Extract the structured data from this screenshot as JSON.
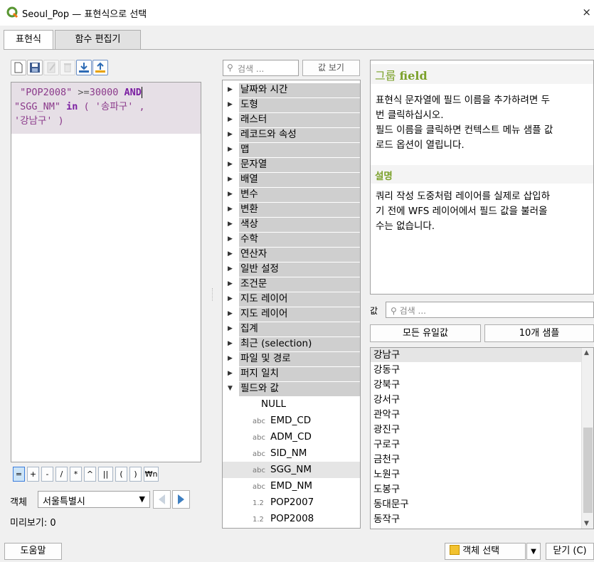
{
  "window": {
    "title": "Seoul_Pop — 표현식으로 선택",
    "close_glyph": "×"
  },
  "tabs": [
    {
      "label": "표현식",
      "active": true
    },
    {
      "label": "함수 편집기",
      "active": false
    }
  ],
  "toolbar_icons": [
    "new-file-icon",
    "save-icon",
    "edit-icon",
    "delete-icon",
    "load-icon",
    "export-icon"
  ],
  "expression": {
    "line1": {
      "pre": " ",
      "field": "\"POP2008\"",
      "op": " >=",
      "num": "30000",
      "kw": " AND"
    },
    "line2": {
      "field": "\"SGG_NM\"",
      "kw": " in",
      "rest": " ( '송파구' ,"
    },
    "line3": {
      "rest": "'강남구' )"
    }
  },
  "operators": [
    "=",
    "+",
    "-",
    "/",
    "*",
    "^",
    "||",
    "(",
    ")",
    "₩n"
  ],
  "feature": {
    "label": "객체",
    "selected": "서울특별시"
  },
  "preview": "미리보기:  0",
  "function_search": {
    "placeholder": "검색 ..."
  },
  "show_values_label": "값 보기",
  "function_groups": [
    "날짜와 시간",
    "도형",
    "래스터",
    "레코드와 속성",
    "맵",
    "문자열",
    "배열",
    "변수",
    "변환",
    "색상",
    "수학",
    "연산자",
    "일반 설정",
    "조건문",
    "지도 레이어",
    "지도 레이어",
    "집계",
    "최근 (selection)",
    "파일 및 경로",
    "퍼지 일치",
    "필드와 값"
  ],
  "fields": [
    {
      "type": "",
      "name": "NULL"
    },
    {
      "type": "abc",
      "name": "EMD_CD"
    },
    {
      "type": "abc",
      "name": "ADM_CD"
    },
    {
      "type": "abc",
      "name": "SID_NM"
    },
    {
      "type": "abc",
      "name": "SGG_NM",
      "selected": true
    },
    {
      "type": "abc",
      "name": "EMD_NM"
    },
    {
      "type": "1.2",
      "name": "POP2007"
    },
    {
      "type": "1.2",
      "name": "POP2008"
    }
  ],
  "help": {
    "title_prefix": "그룹",
    "title_name": "field",
    "para1_lines": [
      "표현식 문자열에 필드 이름을 추가하려면 두",
      "번 클릭하십시오."
    ],
    "para2_lines": [
      "필드 이름을 클릭하면 컨텍스트 메뉴 샘플 값",
      "로드 옵션이 열립니다."
    ],
    "desc_title": "설명",
    "desc_lines": [
      "쿼리 작성 도중처럼 레이어를 실제로 삽입하",
      "기 전에 WFS 레이어에서 필드 값을 불러올",
      "수는 없습니다."
    ]
  },
  "values": {
    "label": "값",
    "search_placeholder": "검색 ...",
    "all_unique_label": "모든 유일값",
    "sample_label": "10개 샘플",
    "items": [
      "강남구",
      "강동구",
      "강북구",
      "강서구",
      "관악구",
      "광진구",
      "구로구",
      "금천구",
      "노원구",
      "도봉구",
      "동대문구",
      "동작구"
    ]
  },
  "bottom": {
    "help_label": "도움말",
    "select_features_label": "객체 선택",
    "close_label": "닫기 (C)"
  },
  "colors": {
    "accent_green": "#7ba12a",
    "keyword_purple": "#7b1fa2",
    "string_purple": "#8b3a8b",
    "selection_gray": "#e5e5e5"
  }
}
